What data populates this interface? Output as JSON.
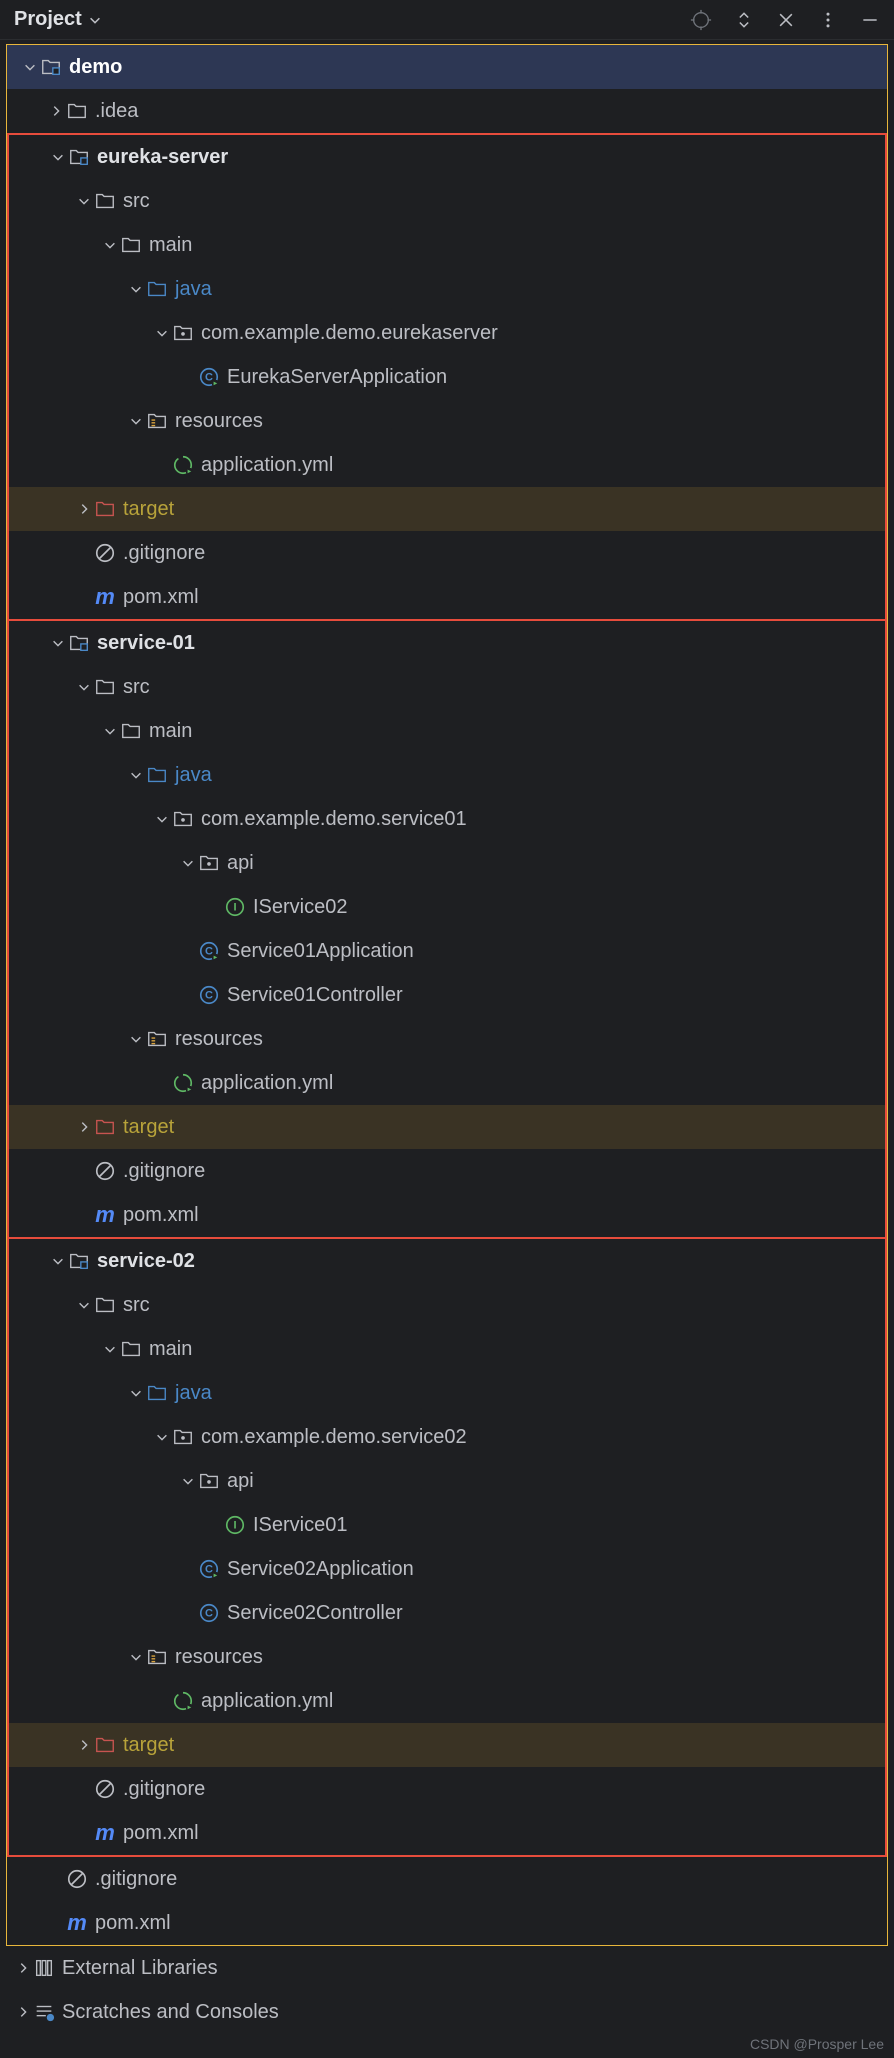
{
  "header": {
    "title": "Project"
  },
  "tree": {
    "root": "demo",
    "idea": ".idea",
    "modules": [
      {
        "name": "eureka-server",
        "src": "src",
        "main": "main",
        "java": "java",
        "pkg": "com.example.demo.eurekaserver",
        "classes": [
          "EurekaServerApplication"
        ],
        "resources": "resources",
        "resfile": "application.yml",
        "target": "target",
        "gitignore": ".gitignore",
        "pom": "pom.xml"
      },
      {
        "name": "service-01",
        "src": "src",
        "main": "main",
        "java": "java",
        "pkg": "com.example.demo.service01",
        "api": "api",
        "apiclass": "IService02",
        "classes": [
          "Service01Application",
          "Service01Controller"
        ],
        "resources": "resources",
        "resfile": "application.yml",
        "target": "target",
        "gitignore": ".gitignore",
        "pom": "pom.xml"
      },
      {
        "name": "service-02",
        "src": "src",
        "main": "main",
        "java": "java",
        "pkg": "com.example.demo.service02",
        "api": "api",
        "apiclass": "IService01",
        "classes": [
          "Service02Application",
          "Service02Controller"
        ],
        "resources": "resources",
        "resfile": "application.yml",
        "target": "target",
        "gitignore": ".gitignore",
        "pom": "pom.xml"
      }
    ],
    "gitignore": ".gitignore",
    "pom": "pom.xml",
    "external": "External Libraries",
    "scratches": "Scratches and Consoles"
  },
  "watermark": "CSDN @Prosper Lee"
}
